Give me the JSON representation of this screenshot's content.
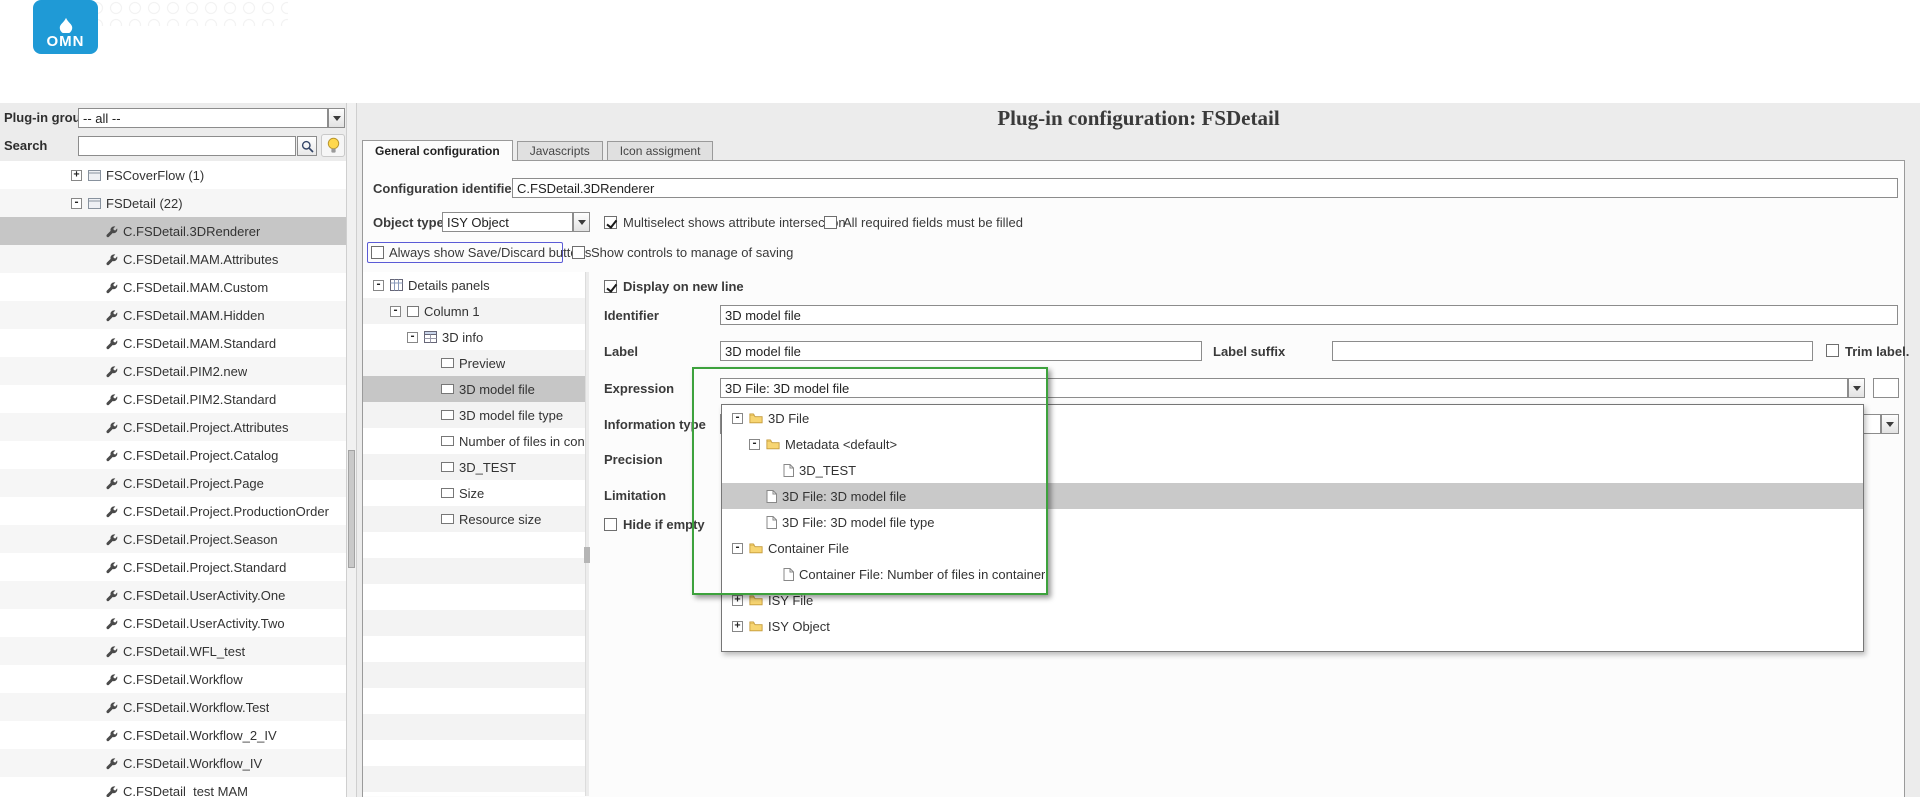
{
  "colors": {
    "logo_blue": "#1f9ad6",
    "selection_gray": "#c6c6c6",
    "annotation_green": "#3da23d"
  },
  "logo": {
    "text": "OMN"
  },
  "sidebar": {
    "plugin_group_label": "Plug-in group",
    "plugin_group_value": "-- all --",
    "search_label": "Search",
    "tree": [
      {
        "label": "FSCoverFlow (1)",
        "indent": 3,
        "expand": "plus",
        "icon": "module"
      },
      {
        "label": "FSDetail (22)",
        "indent": 3,
        "expand": "minus",
        "icon": "module"
      },
      {
        "label": "C.FSDetail.3DRenderer",
        "indent": 4,
        "icon": "wrench",
        "selected": true
      },
      {
        "label": "C.FSDetail.MAM.Attributes",
        "indent": 4,
        "icon": "wrench"
      },
      {
        "label": "C.FSDetail.MAM.Custom",
        "indent": 4,
        "icon": "wrench"
      },
      {
        "label": "C.FSDetail.MAM.Hidden",
        "indent": 4,
        "icon": "wrench"
      },
      {
        "label": "C.FSDetail.MAM.Standard",
        "indent": 4,
        "icon": "wrench"
      },
      {
        "label": "C.FSDetail.PIM2.new",
        "indent": 4,
        "icon": "wrench"
      },
      {
        "label": "C.FSDetail.PIM2.Standard",
        "indent": 4,
        "icon": "wrench"
      },
      {
        "label": "C.FSDetail.Project.Attributes",
        "indent": 4,
        "icon": "wrench"
      },
      {
        "label": "C.FSDetail.Project.Catalog",
        "indent": 4,
        "icon": "wrench"
      },
      {
        "label": "C.FSDetail.Project.Page",
        "indent": 4,
        "icon": "wrench"
      },
      {
        "label": "C.FSDetail.Project.ProductionOrder",
        "indent": 4,
        "icon": "wrench"
      },
      {
        "label": "C.FSDetail.Project.Season",
        "indent": 4,
        "icon": "wrench"
      },
      {
        "label": "C.FSDetail.Project.Standard",
        "indent": 4,
        "icon": "wrench"
      },
      {
        "label": "C.FSDetail.UserActivity.One",
        "indent": 4,
        "icon": "wrench"
      },
      {
        "label": "C.FSDetail.UserActivity.Two",
        "indent": 4,
        "icon": "wrench"
      },
      {
        "label": "C.FSDetail.WFL_test",
        "indent": 4,
        "icon": "wrench"
      },
      {
        "label": "C.FSDetail.Workflow",
        "indent": 4,
        "icon": "wrench"
      },
      {
        "label": "C.FSDetail.Workflow.Test",
        "indent": 4,
        "icon": "wrench"
      },
      {
        "label": "C.FSDetail.Workflow_2_IV",
        "indent": 4,
        "icon": "wrench"
      },
      {
        "label": "C.FSDetail.Workflow_IV",
        "indent": 4,
        "icon": "wrench"
      },
      {
        "label": "C.FSDetail_test MAM",
        "indent": 4,
        "icon": "wrench"
      }
    ]
  },
  "main": {
    "title": "Plug-in configuration: FSDetail",
    "tabs": [
      {
        "label": "General configuration",
        "active": true
      },
      {
        "label": "Javascripts",
        "active": false
      },
      {
        "label": "Icon assigment",
        "active": false
      }
    ]
  },
  "form": {
    "configuration_identifier": {
      "label": "Configuration identifier",
      "value": "C.FSDetail.3DRenderer"
    },
    "object_type": {
      "label": "Object type",
      "value": "ISY Object"
    },
    "multiselect_intersection": {
      "label": "Multiselect shows attribute intersection",
      "checked": true
    },
    "all_required": {
      "label": "All required fields must be filled",
      "checked": false
    },
    "always_show_save": {
      "label": "Always show Save/Discard buttons",
      "checked": false
    },
    "show_controls_saving": {
      "label": "Show controls to manage of saving",
      "checked": false
    },
    "display_on_new_line": {
      "label": "Display on new line",
      "checked": true
    },
    "identifier": {
      "label": "Identifier",
      "value": "3D model file"
    },
    "field_label": {
      "label": "Label",
      "value": "3D model file"
    },
    "label_suffix": {
      "label": "Label suffix",
      "value": ""
    },
    "trim_label": {
      "label": "Trim label.",
      "checked": false
    },
    "expression": {
      "label": "Expression",
      "value": "3D File: 3D model file"
    },
    "information_type": {
      "label": "Information type",
      "value": ""
    },
    "precision": {
      "label": "Precision"
    },
    "limitation": {
      "label": "Limitation"
    },
    "hide_if_empty": {
      "label": "Hide if empty",
      "checked": false
    }
  },
  "details_tree": [
    {
      "label": "Details panels",
      "indent": 0,
      "expand": "minus",
      "icon": "grid"
    },
    {
      "label": "Column 1",
      "indent": 1,
      "expand": "minus",
      "icon": "column"
    },
    {
      "label": "3D info",
      "indent": 2,
      "expand": "minus",
      "icon": "table"
    },
    {
      "label": "Preview",
      "indent": 3,
      "icon": "field"
    },
    {
      "label": "3D model file",
      "indent": 3,
      "icon": "field",
      "selected": true
    },
    {
      "label": "3D model file type",
      "indent": 3,
      "icon": "field"
    },
    {
      "label": "Number of files in container",
      "indent": 3,
      "icon": "field"
    },
    {
      "label": "3D_TEST",
      "indent": 3,
      "icon": "field"
    },
    {
      "label": "Size",
      "indent": 3,
      "icon": "field"
    },
    {
      "label": "Resource size",
      "indent": 3,
      "icon": "field"
    }
  ],
  "expression_dropdown": {
    "items": [
      {
        "label": "3D File",
        "indent": 0,
        "expand": "minus",
        "icon": "folder"
      },
      {
        "label": "Metadata <default>",
        "indent": 1,
        "expand": "minus",
        "icon": "folder"
      },
      {
        "label": "3D_TEST",
        "indent": 2,
        "icon": "file"
      },
      {
        "label": "3D File: 3D model file",
        "indent": 1,
        "icon": "file",
        "selected": true
      },
      {
        "label": "3D File: 3D model file type",
        "indent": 1,
        "icon": "file"
      },
      {
        "label": "Container File",
        "indent": 0,
        "expand": "minus",
        "icon": "folder"
      },
      {
        "label": "Container File: Number of files in container",
        "indent": 2,
        "icon": "file"
      },
      {
        "label": "ISY File",
        "indent": 0,
        "expand": "plus",
        "icon": "folder"
      },
      {
        "label": "ISY Object",
        "indent": 0,
        "expand": "plus",
        "icon": "folder"
      }
    ]
  }
}
